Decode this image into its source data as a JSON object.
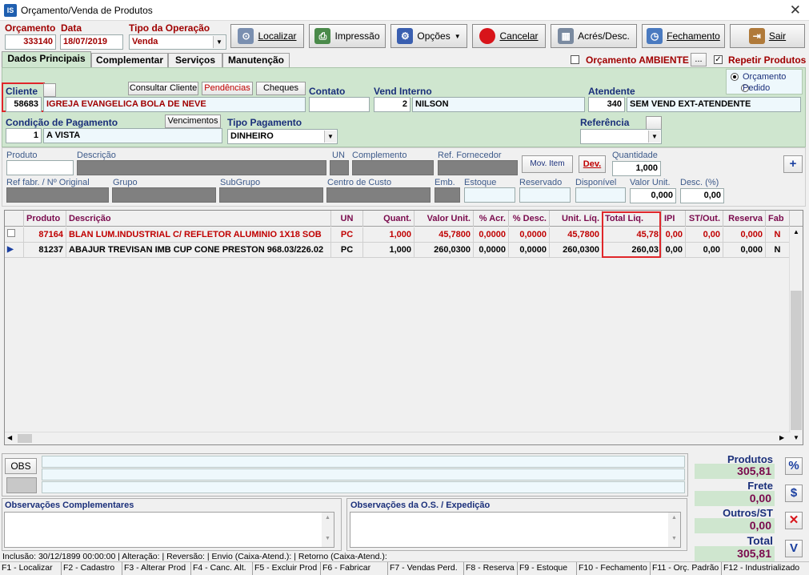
{
  "window": {
    "title": "Orçamento/Venda de Produtos",
    "app_badge": "IS"
  },
  "header": {
    "orcamento_label": "Orçamento",
    "orcamento_value": "333140",
    "data_label": "Data",
    "data_value": "18/07/2019",
    "tipo_label": "Tipo da Operação",
    "tipo_value": "Venda"
  },
  "toolbar": {
    "localizar": "Localizar",
    "impressao": "Impressão",
    "opcoes": "Opções",
    "cancelar": "Cancelar",
    "acres_desc": "Acrés/Desc.",
    "fechamento": "Fechamento",
    "sair": "Sair"
  },
  "tabs": [
    "Dados Principais",
    "Complementar",
    "Serviços",
    "Manutenção"
  ],
  "options": {
    "ambiente_label": "Orçamento AMBIENTE",
    "ambiente_btn": "...",
    "repetir_label": "Repetir Produtos",
    "repetir_check": "✓"
  },
  "main": {
    "cliente_label": "Cliente",
    "cliente_code": "58683",
    "cliente_name": "IGREJA EVANGELICA BOLA DE NEVE",
    "consultar_btn": "Consultar Cliente",
    "pendencias_btn": "Pendências",
    "cheques_btn": "Cheques",
    "contato_label": "Contato",
    "contato_value": "",
    "vend_label": "Vend Interno",
    "vend_code": "2",
    "vend_name": "NILSON",
    "atendente_label": "Atendente",
    "atendente_code": "340",
    "atendente_name": "SEM VEND EXT-ATENDENTE",
    "radio_orcamento": "Orçamento",
    "radio_pedido": "Pedido",
    "cond_label": "Condição de Pagamento",
    "cond_code": "1",
    "cond_name": "A VISTA",
    "vencimentos_btn": "Vencimentos",
    "tipo_pag_label": "Tipo Pagamento",
    "tipo_pag_value": "DINHEIRO",
    "referencia_label": "Referência",
    "referencia_value": ""
  },
  "product_fields": {
    "produto": "Produto",
    "descricao": "Descrição",
    "un": "UN",
    "complemento": "Complemento",
    "ref_fornecedor": "Ref. Fornecedor",
    "mov_item": "Mov. Item",
    "dev": "Dev.",
    "quantidade": "Quantidade",
    "quantidade_value": "1,000",
    "add": "+",
    "ref_fabr": "Ref fabr. / Nº Original",
    "grupo": "Grupo",
    "subgrupo": "SubGrupo",
    "centro_custo": "Centro de Custo",
    "emb": "Emb.",
    "estoque": "Estoque",
    "reservado": "Reservado",
    "disponivel": "Disponível",
    "valor_unit": "Valor Unit.",
    "valor_unit_value": "0,000",
    "desc_pct": "Desc. (%)",
    "desc_pct_value": "0,00"
  },
  "grid": {
    "columns": [
      "Produto",
      "Descrição",
      "UN",
      "Quant.",
      "Valor Unit.",
      "% Acr.",
      "% Desc.",
      "Unit. Líq.",
      "Total Liq.",
      "IPI",
      "ST/Out.",
      "Reserva",
      "Fab"
    ],
    "rows": [
      {
        "indicator": "",
        "produto": "87164",
        "descricao": "BLAN LUM.INDUSTRIAL C/ REFLETOR ALUMINIO 1X18 SOB",
        "un": "PC",
        "quant": "1,000",
        "valor_unit": "45,7800",
        "acr": "0,0000",
        "desc": "0,0000",
        "unit_liq": "45,7800",
        "total_liq": "45,78",
        "ipi": "0,00",
        "st": "0,00",
        "reserva": "0,000",
        "fab": "N"
      },
      {
        "indicator": "▶",
        "produto": "81237",
        "descricao": "ABAJUR TREVISAN IMB CUP CONE PRESTON 968.03/226.02",
        "un": "PC",
        "quant": "1,000",
        "valor_unit": "260,0300",
        "acr": "0,0000",
        "desc": "0,0000",
        "unit_liq": "260,0300",
        "total_liq": "260,03",
        "ipi": "0,00",
        "st": "0,00",
        "reserva": "0,000",
        "fab": "N"
      }
    ]
  },
  "obs": {
    "obs_btn": "OBS",
    "complementares_label": "Observações Complementares",
    "os_label": "Observações da O.S. / Expedição"
  },
  "totals": {
    "produtos_label": "Produtos",
    "produtos_value": "305,81",
    "frete_label": "Frete",
    "frete_value": "0,00",
    "outros_label": "Outros/ST",
    "outros_value": "0,00",
    "total_label": "Total",
    "total_value": "305,81"
  },
  "side_buttons": {
    "percent": "%",
    "dollar": "$",
    "cancel": "✕",
    "down": "V"
  },
  "info_line": "Inclusão:  30/12/1899 00:00:00 | Alteração:  | Reversão:  | Envio (Caixa-Atend.):  | Retorno (Caixa-Atend.):",
  "function_keys": [
    "F1 - Localizar",
    "F2 - Cadastro",
    "F3 - Alterar Prod",
    "F4 - Canc. Alt.",
    "F5 - Excluir Prod",
    "F6 - Fabricar",
    "F7 - Vendas Perd.",
    "F8 - Reserva",
    "F9 - Estoque",
    "F10 - Fechamento",
    "F11 - Orç. Padrão",
    "F12 - Industrializado"
  ],
  "colors": {
    "accent_red": "#a00000",
    "label_blue": "#1a2f7a",
    "panel_green": "#cfe6cf",
    "header_purple": "#7a0a4d",
    "highlight": "#e0262a"
  }
}
